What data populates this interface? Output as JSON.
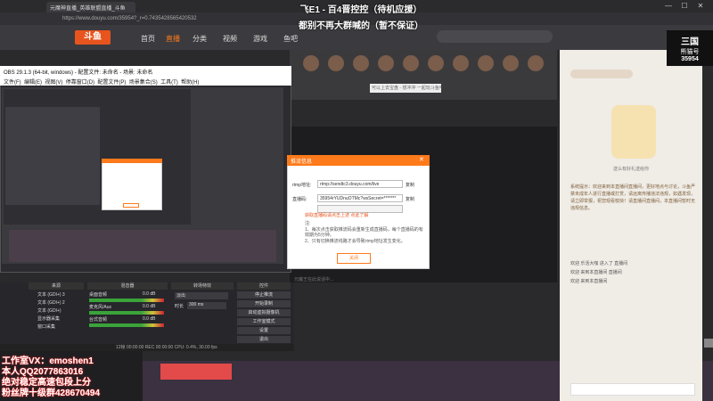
{
  "browser": {
    "tab_title": "元魔神直播_英雄联盟直播_斗鱼",
    "url": "https://www.douyu.com/35954?_r=0.7435428565420532",
    "min": "—",
    "max": "☐",
    "close": "✕"
  },
  "overlay": {
    "line1": "飞E1 - 百4晋控控（待机应援）",
    "line2": "都别不再大群喊的（暂不保证）"
  },
  "nav": {
    "logo": "斗鱼",
    "items": [
      "首页",
      "直播",
      "分类",
      "视频",
      "游戏",
      "鱼吧"
    ]
  },
  "badge": {
    "line1": "三国",
    "line2": "熊猫号",
    "line3": "35954"
  },
  "gifts": {
    "label": "可以上去宝盘 - 想冲冲 一起玩斗鱼吧"
  },
  "player": {
    "below": "元魔王在此说话中..."
  },
  "obs": {
    "title": "OBS 29.1.3 (64-bit, windows) - 配置文件: 未命名 - 场景: 未命名",
    "menu": [
      "文件(F)",
      "编辑(E)",
      "视图(V)",
      "停靠窗口(D)",
      "配置文件(P)",
      "场景集合(S)",
      "工具(T)",
      "帮助(H)"
    ],
    "dock_headers": [
      "来源",
      "混音器",
      "转场特效",
      "控件"
    ],
    "sources": [
      "文本 (GDI+) 3",
      "文本 (GDI+) 2",
      "文本 (GDI+)",
      "显示器采集",
      "窗口采集"
    ],
    "mixer": [
      {
        "name": "桌面音频",
        "value": "0.0 dB"
      },
      {
        "name": "麦克风/Aux",
        "value": "0.0 dB"
      },
      {
        "name": "台式音频",
        "value": "0.0 dB"
      }
    ],
    "transition": {
      "type": "淡出",
      "duration_label": "时长",
      "duration": "300 ms"
    },
    "controls": [
      "停止推流",
      "开始录制",
      "启动虚拟摄像机",
      "工作室模式",
      "设置",
      "退出"
    ],
    "status": "12帧  00:00:00   REC 00:00:00   CPU: 0.4%, 30.00 fps"
  },
  "dialog": {
    "title": "推流信息",
    "close": "✕",
    "rtmp_label": "rtmp地址:",
    "rtmp_value": "rtmp://sendtc3.douyu.com/live",
    "code_label": "直播码:",
    "code_value": "35954rYUDnuOTMc?wsSecret=*******",
    "copy": "复制",
    "link": "获取直播码请点击上述    点此了解",
    "note_title": "注:",
    "note1": "1、每次点击获取推流码会重新生成直播码，每个直播码的有效期为5分钟。",
    "note2": "2、只有切换推流线路才会导致rtmp地址发生变化。",
    "ok": "关闭"
  },
  "chat": {
    "caption": "送么有好礼送给你",
    "welcome": "系统提示：欢迎来到本直播间直播间，更好地点与讨论，斗鱼严禁未成年人进行直播或打赏，请远离传播违法违规，如遇发现，请立即举报，祝您观看愉快！请直播间直播间，本直播间暂时无违规信息。",
    "lines": [
      "欢迎 乐活大咖 进入了 直播间",
      "欢迎 来到本直播间 直播间",
      "欢迎 来到本直播间"
    ]
  },
  "contact": [
    "工作室VX：emoshen1",
    "本人QQ2077863016",
    "绝对稳定高速包段上分",
    "粉丝牌十级群428670494"
  ]
}
